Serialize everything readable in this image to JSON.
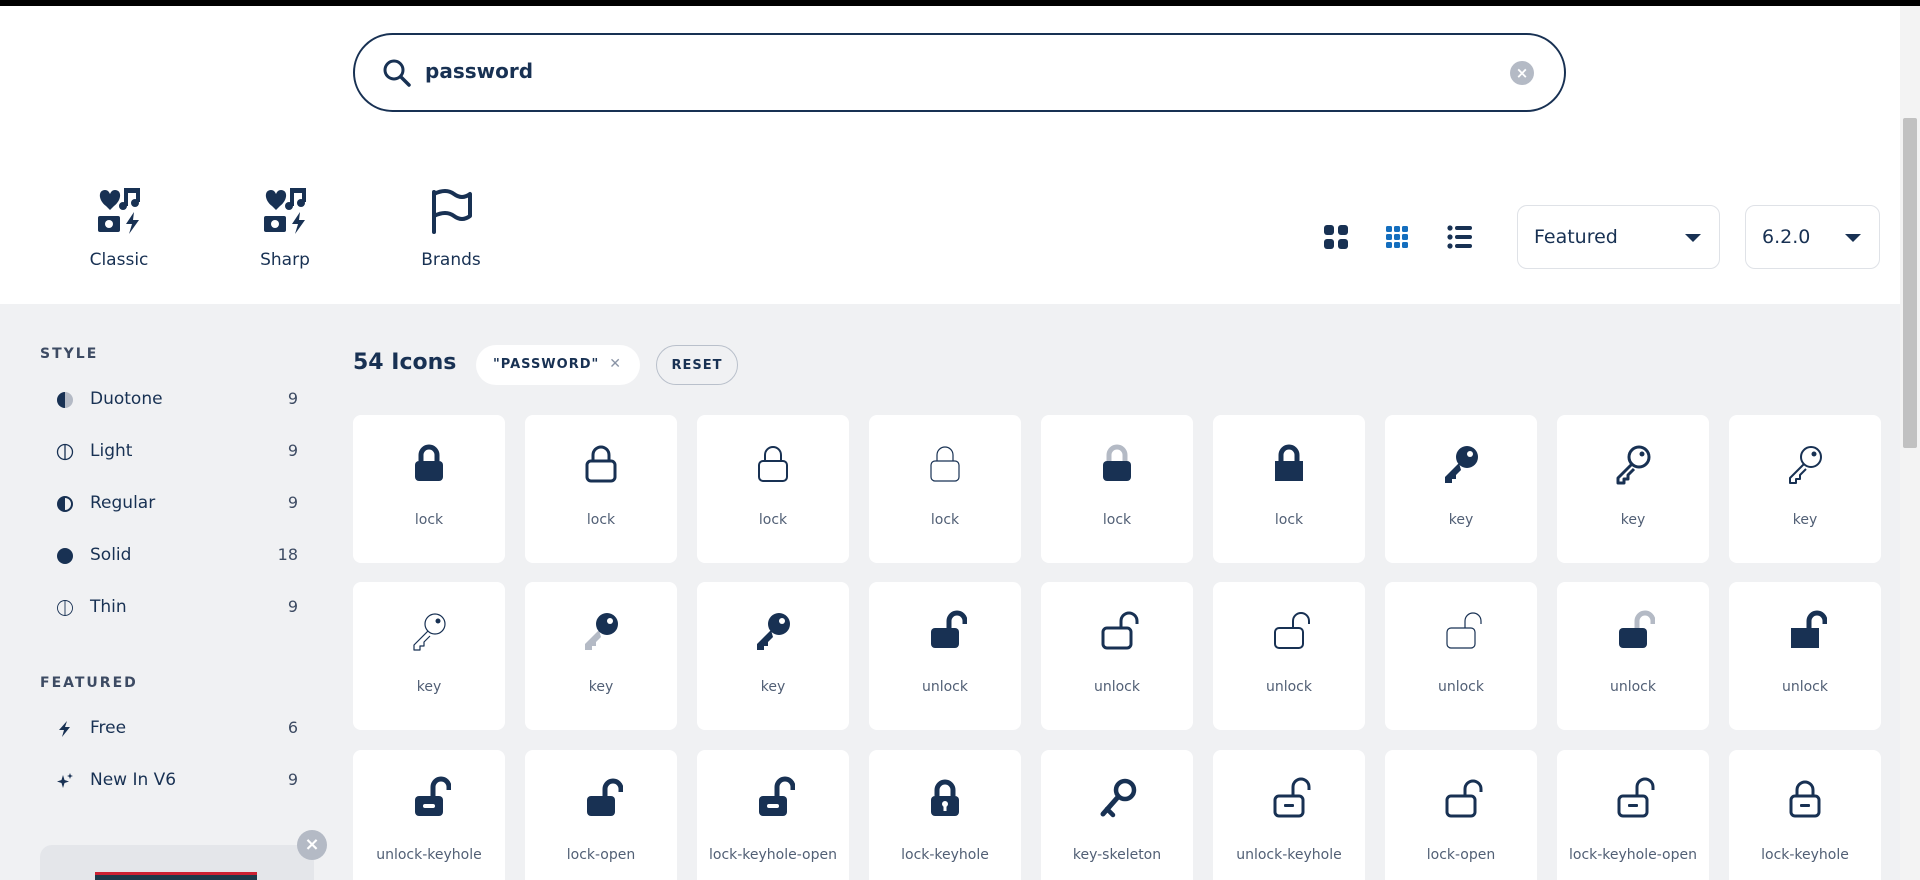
{
  "search": {
    "query": "password"
  },
  "families": [
    {
      "label": "Classic",
      "icon": "classic-icon"
    },
    {
      "label": "Sharp",
      "icon": "sharp-icon"
    },
    {
      "label": "Brands",
      "icon": "flag-icon"
    }
  ],
  "view": {
    "active": "grid-small"
  },
  "sort": {
    "selected": "Featured"
  },
  "version": {
    "selected": "6.2.0"
  },
  "sidebar": {
    "style_heading": "STYLE",
    "styles": [
      {
        "label": "Duotone",
        "count": "9",
        "icon": "duotone-circle-icon"
      },
      {
        "label": "Light",
        "count": "9",
        "icon": "light-circle-icon"
      },
      {
        "label": "Regular",
        "count": "9",
        "icon": "regular-circle-icon"
      },
      {
        "label": "Solid",
        "count": "18",
        "icon": "solid-circle-icon"
      },
      {
        "label": "Thin",
        "count": "9",
        "icon": "thin-circle-icon"
      }
    ],
    "featured_heading": "FEATURED",
    "featured": [
      {
        "label": "Free",
        "count": "6",
        "icon": "bolt-icon"
      },
      {
        "label": "New In V6",
        "count": "9",
        "icon": "sparkles-icon"
      }
    ]
  },
  "results": {
    "count_label": "54 Icons",
    "term_chip": "\"PASSWORD\"",
    "reset_label": "RESET"
  },
  "icons": [
    {
      "label": "lock",
      "glyph": "lock",
      "variant": "solid"
    },
    {
      "label": "lock",
      "glyph": "lock",
      "variant": "regular"
    },
    {
      "label": "lock",
      "glyph": "lock",
      "variant": "light"
    },
    {
      "label": "lock",
      "glyph": "lock",
      "variant": "thin"
    },
    {
      "label": "lock",
      "glyph": "lock",
      "variant": "duotone"
    },
    {
      "label": "lock",
      "glyph": "lock",
      "variant": "sharp"
    },
    {
      "label": "key",
      "glyph": "key",
      "variant": "solid"
    },
    {
      "label": "key",
      "glyph": "key",
      "variant": "regular"
    },
    {
      "label": "key",
      "glyph": "key",
      "variant": "light"
    },
    {
      "label": "key",
      "glyph": "key",
      "variant": "thin"
    },
    {
      "label": "key",
      "glyph": "key",
      "variant": "duotone"
    },
    {
      "label": "key",
      "glyph": "key",
      "variant": "sharp"
    },
    {
      "label": "unlock",
      "glyph": "unlock",
      "variant": "solid"
    },
    {
      "label": "unlock",
      "glyph": "unlock",
      "variant": "regular"
    },
    {
      "label": "unlock",
      "glyph": "unlock",
      "variant": "light"
    },
    {
      "label": "unlock",
      "glyph": "unlock",
      "variant": "thin"
    },
    {
      "label": "unlock",
      "glyph": "unlock",
      "variant": "duotone"
    },
    {
      "label": "unlock",
      "glyph": "unlock",
      "variant": "sharp"
    },
    {
      "label": "unlock-keyhole",
      "glyph": "unlock-keyhole",
      "variant": "solid"
    },
    {
      "label": "lock-open",
      "glyph": "lock-open",
      "variant": "solid"
    },
    {
      "label": "lock-keyhole-open",
      "glyph": "lock-keyhole-open",
      "variant": "solid"
    },
    {
      "label": "lock-keyhole",
      "glyph": "lock-keyhole",
      "variant": "solid"
    },
    {
      "label": "key-skeleton",
      "glyph": "key-skeleton",
      "variant": "solid"
    },
    {
      "label": "unlock-keyhole",
      "glyph": "unlock-keyhole",
      "variant": "regular"
    },
    {
      "label": "lock-open",
      "glyph": "lock-open",
      "variant": "regular"
    },
    {
      "label": "lock-keyhole-open",
      "glyph": "lock-keyhole-open",
      "variant": "regular"
    },
    {
      "label": "lock-keyhole",
      "glyph": "lock-keyhole",
      "variant": "regular"
    }
  ],
  "colors": {
    "navy": "#183153",
    "accent": "#146ebe",
    "muted": "#b4bac5",
    "tile_bg": "#ffffff",
    "page_bg": "#f0f1f3"
  }
}
